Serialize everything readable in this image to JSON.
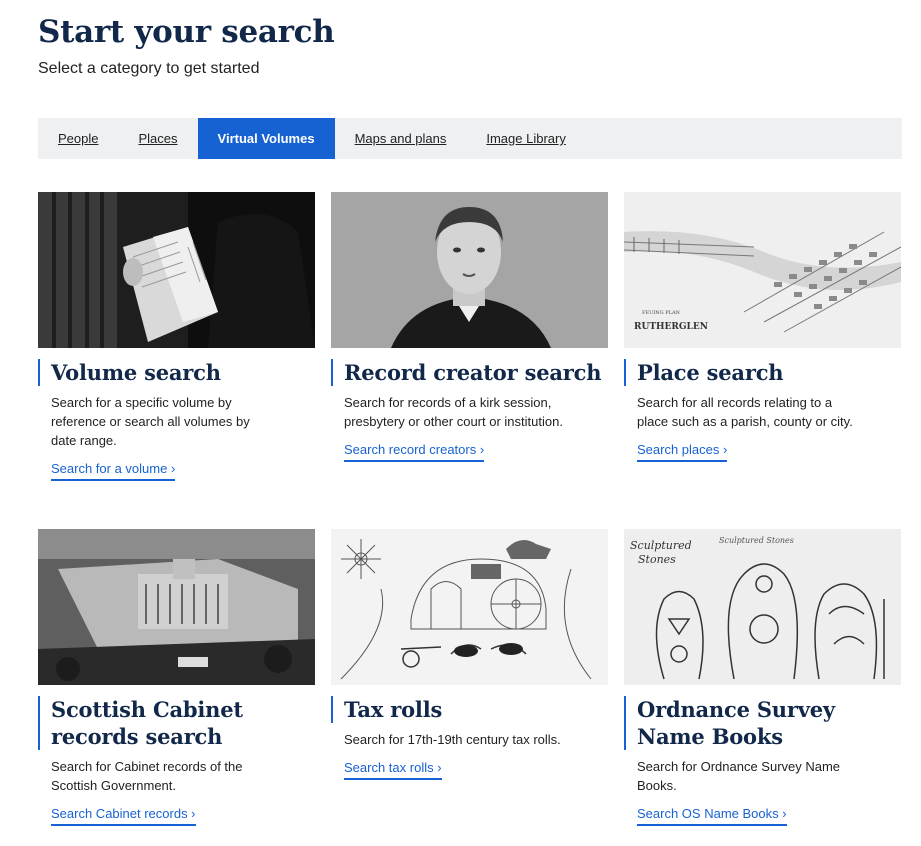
{
  "header": {
    "title": "Start your search",
    "subtitle": "Select a category to get started"
  },
  "tabs": [
    {
      "label": "People",
      "active": false
    },
    {
      "label": "Places",
      "active": false
    },
    {
      "label": "Virtual Volumes",
      "active": true
    },
    {
      "label": "Maps and plans",
      "active": false
    },
    {
      "label": "Image Library",
      "active": false
    }
  ],
  "colors": {
    "accent": "#1762d3",
    "heading": "#12284a",
    "tab_bar": "#eef0f2"
  },
  "cards": [
    {
      "title": "Volume search",
      "description": "Search for a specific volume by reference or search all volumes by date range.",
      "link": "Search for a volume ›"
    },
    {
      "title": "Record creator search",
      "description": "Search for records of a kirk session, presbytery or other court or institution.",
      "link": "Search record creators ›"
    },
    {
      "title": "Place search",
      "description": "Search for all records relating to a place such as a parish, county or city.",
      "link": "Search places  ›"
    },
    {
      "title": "Scottish Cabinet records search",
      "description": "Search for Cabinet records of the Scottish Government.",
      "link": "Search Cabinet records ›"
    },
    {
      "title": "Tax rolls",
      "description": "Search for 17th-19th century tax rolls.",
      "link": "Search tax rolls ›"
    },
    {
      "title": "Ordnance Survey Name Books",
      "description": "Search for Ordnance Survey Name Books.",
      "link": "Search OS Name Books ›"
    }
  ],
  "image_text": {
    "plan_caption_1": "FEUING PLAN",
    "plan_caption_2": "RUTHERGLEN",
    "stones_title_1": "Sculptured",
    "stones_title_2": "Stones",
    "stones_script": "Sculptured Stones"
  }
}
